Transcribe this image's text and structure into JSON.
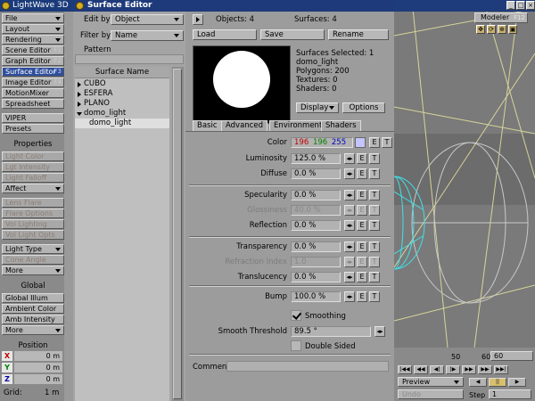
{
  "main": {
    "title": "LightWave 3D",
    "toolbar": [
      {
        "label": "File",
        "type": "drop"
      },
      {
        "label": "Layout",
        "type": "drop"
      },
      {
        "label": "Rendering",
        "type": "drop"
      },
      {
        "label": "Scene Editor",
        "key": "F1"
      },
      {
        "label": "Graph Editor",
        "key": "F2"
      },
      {
        "label": "Surface Editor",
        "key": "F3",
        "selected": true
      },
      {
        "label": "Image Editor",
        "key": "F4"
      },
      {
        "label": "MotionMixer"
      },
      {
        "label": "Spreadsheet"
      }
    ],
    "toolbar2": [
      {
        "label": "VIPER"
      },
      {
        "label": "Presets"
      }
    ],
    "properties_heading": "Properties",
    "properties": [
      {
        "label": "Light Color",
        "dim": true
      },
      {
        "label": "Lgt Intensity",
        "dim": true
      },
      {
        "label": "Light Falloff",
        "dim": true
      },
      {
        "label": "Affect",
        "type": "drop"
      },
      {
        "label": "Lens Flare",
        "dim": true
      },
      {
        "label": "Flare Options",
        "dim": true
      },
      {
        "label": "Vol Lighting",
        "dim": true
      },
      {
        "label": "Vol Light Opts",
        "dim": true
      },
      {
        "label": "Light Type",
        "type": "drop"
      },
      {
        "label": "Cone Angle",
        "dim": true
      },
      {
        "label": "More",
        "type": "drop"
      }
    ],
    "global_heading": "Global",
    "global": [
      {
        "label": "Global Illum"
      },
      {
        "label": "Ambient Color"
      },
      {
        "label": "Amb Intensity"
      },
      {
        "label": "More",
        "type": "drop"
      }
    ],
    "position_heading": "Position",
    "coords": [
      {
        "axis": "X",
        "value": "0 m"
      },
      {
        "axis": "Y",
        "value": "0 m"
      },
      {
        "axis": "Z",
        "value": "0 m"
      }
    ],
    "grid_label": "Grid:",
    "grid_value": "1 m"
  },
  "viewport": {
    "modeler_label": "Modeler",
    "modeler_key": "F12",
    "timeline_numbers": [
      "50",
      "60",
      "60"
    ],
    "preview_label": "Preview",
    "undo_label": "Undo",
    "step_label": "Step",
    "step_value": "1"
  },
  "editor": {
    "title": "Surface Editor",
    "edit_by_label": "Edit by",
    "edit_by_value": "Object",
    "filter_by_label": "Filter by",
    "filter_by_value": "Name",
    "pattern_label": "Pattern",
    "list_header": "Surface Name",
    "surfaces": [
      {
        "name": "CUBO",
        "expand": "right"
      },
      {
        "name": "ESFERA",
        "expand": "right"
      },
      {
        "name": "PLANO",
        "expand": "right"
      },
      {
        "name": "domo_light",
        "expand": "down"
      },
      {
        "name": "domo_light",
        "selected": true
      }
    ],
    "objects_label": "Objects: 4",
    "surfaces_label": "Surfaces: 4",
    "load_label": "Load",
    "save_label": "Save",
    "rename_label": "Rename",
    "info": [
      "Surfaces Selected: 1",
      "domo_light",
      "Polygons: 200",
      "Textures: 0",
      "Shaders: 0"
    ],
    "display_label": "Display",
    "options_label": "Options",
    "tabs": [
      "Basic",
      "Advanced",
      "Environment",
      "Shaders"
    ],
    "color_label": "Color",
    "color_r": "196",
    "color_g": "196",
    "color_b": "255",
    "swatch_color": "#c4c4ff",
    "params": [
      {
        "label": "Luminosity",
        "value": "125.0 %"
      },
      {
        "label": "Diffuse",
        "value": "0.0 %"
      },
      {
        "label": "Specularity",
        "value": "0.0 %"
      },
      {
        "label": "Glossiness",
        "value": "40.0 %",
        "dim": true
      },
      {
        "label": "Reflection",
        "value": "0.0 %"
      },
      {
        "label": "Transparency",
        "value": "0.0 %"
      },
      {
        "label": "Refraction Index",
        "value": "1.0",
        "dim": true
      },
      {
        "label": "Translucency",
        "value": "0.0 %"
      },
      {
        "label": "Bump",
        "value": "100.0 %"
      }
    ],
    "env_e": "E",
    "env_t": "T",
    "smoothing_label": "Smoothing",
    "smooth_threshold_label": "Smooth Threshold",
    "smooth_threshold_value": "89.5 °",
    "double_sided_label": "Double Sided",
    "comment_label": "Comment"
  }
}
